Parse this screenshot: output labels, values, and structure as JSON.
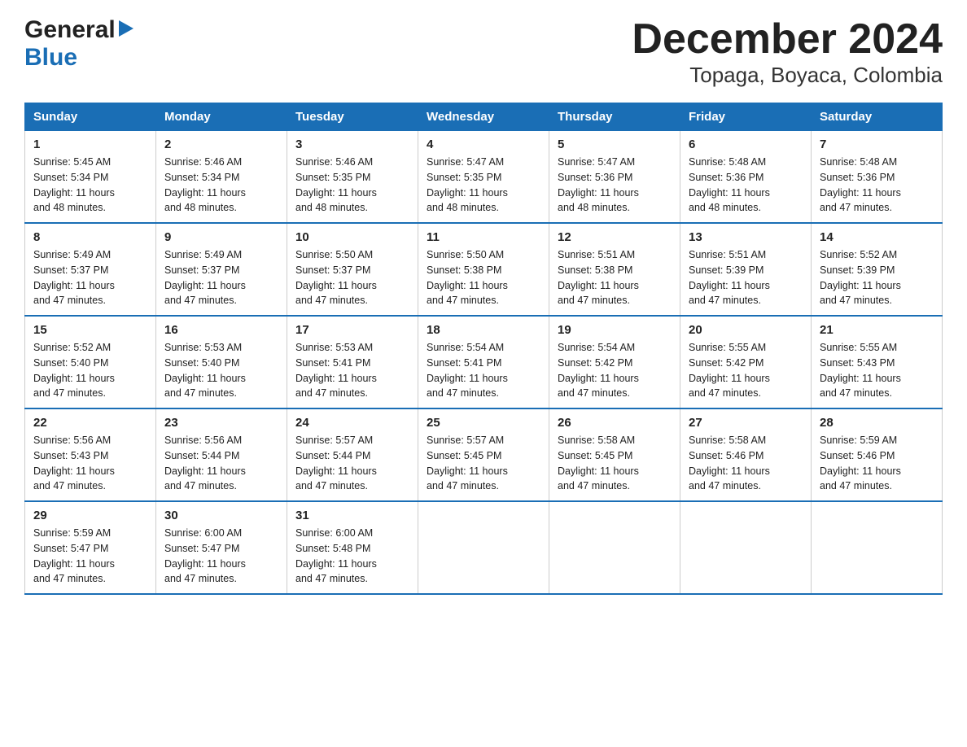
{
  "logo": {
    "general": "General",
    "triangle": "▶",
    "blue": "Blue"
  },
  "title": "December 2024",
  "subtitle": "Topaga, Boyaca, Colombia",
  "days_of_week": [
    "Sunday",
    "Monday",
    "Tuesday",
    "Wednesday",
    "Thursday",
    "Friday",
    "Saturday"
  ],
  "weeks": [
    [
      {
        "day": "1",
        "sunrise": "5:45 AM",
        "sunset": "5:34 PM",
        "daylight": "11 hours and 48 minutes."
      },
      {
        "day": "2",
        "sunrise": "5:46 AM",
        "sunset": "5:34 PM",
        "daylight": "11 hours and 48 minutes."
      },
      {
        "day": "3",
        "sunrise": "5:46 AM",
        "sunset": "5:35 PM",
        "daylight": "11 hours and 48 minutes."
      },
      {
        "day": "4",
        "sunrise": "5:47 AM",
        "sunset": "5:35 PM",
        "daylight": "11 hours and 48 minutes."
      },
      {
        "day": "5",
        "sunrise": "5:47 AM",
        "sunset": "5:36 PM",
        "daylight": "11 hours and 48 minutes."
      },
      {
        "day": "6",
        "sunrise": "5:48 AM",
        "sunset": "5:36 PM",
        "daylight": "11 hours and 48 minutes."
      },
      {
        "day": "7",
        "sunrise": "5:48 AM",
        "sunset": "5:36 PM",
        "daylight": "11 hours and 47 minutes."
      }
    ],
    [
      {
        "day": "8",
        "sunrise": "5:49 AM",
        "sunset": "5:37 PM",
        "daylight": "11 hours and 47 minutes."
      },
      {
        "day": "9",
        "sunrise": "5:49 AM",
        "sunset": "5:37 PM",
        "daylight": "11 hours and 47 minutes."
      },
      {
        "day": "10",
        "sunrise": "5:50 AM",
        "sunset": "5:37 PM",
        "daylight": "11 hours and 47 minutes."
      },
      {
        "day": "11",
        "sunrise": "5:50 AM",
        "sunset": "5:38 PM",
        "daylight": "11 hours and 47 minutes."
      },
      {
        "day": "12",
        "sunrise": "5:51 AM",
        "sunset": "5:38 PM",
        "daylight": "11 hours and 47 minutes."
      },
      {
        "day": "13",
        "sunrise": "5:51 AM",
        "sunset": "5:39 PM",
        "daylight": "11 hours and 47 minutes."
      },
      {
        "day": "14",
        "sunrise": "5:52 AM",
        "sunset": "5:39 PM",
        "daylight": "11 hours and 47 minutes."
      }
    ],
    [
      {
        "day": "15",
        "sunrise": "5:52 AM",
        "sunset": "5:40 PM",
        "daylight": "11 hours and 47 minutes."
      },
      {
        "day": "16",
        "sunrise": "5:53 AM",
        "sunset": "5:40 PM",
        "daylight": "11 hours and 47 minutes."
      },
      {
        "day": "17",
        "sunrise": "5:53 AM",
        "sunset": "5:41 PM",
        "daylight": "11 hours and 47 minutes."
      },
      {
        "day": "18",
        "sunrise": "5:54 AM",
        "sunset": "5:41 PM",
        "daylight": "11 hours and 47 minutes."
      },
      {
        "day": "19",
        "sunrise": "5:54 AM",
        "sunset": "5:42 PM",
        "daylight": "11 hours and 47 minutes."
      },
      {
        "day": "20",
        "sunrise": "5:55 AM",
        "sunset": "5:42 PM",
        "daylight": "11 hours and 47 minutes."
      },
      {
        "day": "21",
        "sunrise": "5:55 AM",
        "sunset": "5:43 PM",
        "daylight": "11 hours and 47 minutes."
      }
    ],
    [
      {
        "day": "22",
        "sunrise": "5:56 AM",
        "sunset": "5:43 PM",
        "daylight": "11 hours and 47 minutes."
      },
      {
        "day": "23",
        "sunrise": "5:56 AM",
        "sunset": "5:44 PM",
        "daylight": "11 hours and 47 minutes."
      },
      {
        "day": "24",
        "sunrise": "5:57 AM",
        "sunset": "5:44 PM",
        "daylight": "11 hours and 47 minutes."
      },
      {
        "day": "25",
        "sunrise": "5:57 AM",
        "sunset": "5:45 PM",
        "daylight": "11 hours and 47 minutes."
      },
      {
        "day": "26",
        "sunrise": "5:58 AM",
        "sunset": "5:45 PM",
        "daylight": "11 hours and 47 minutes."
      },
      {
        "day": "27",
        "sunrise": "5:58 AM",
        "sunset": "5:46 PM",
        "daylight": "11 hours and 47 minutes."
      },
      {
        "day": "28",
        "sunrise": "5:59 AM",
        "sunset": "5:46 PM",
        "daylight": "11 hours and 47 minutes."
      }
    ],
    [
      {
        "day": "29",
        "sunrise": "5:59 AM",
        "sunset": "5:47 PM",
        "daylight": "11 hours and 47 minutes."
      },
      {
        "day": "30",
        "sunrise": "6:00 AM",
        "sunset": "5:47 PM",
        "daylight": "11 hours and 47 minutes."
      },
      {
        "day": "31",
        "sunrise": "6:00 AM",
        "sunset": "5:48 PM",
        "daylight": "11 hours and 47 minutes."
      },
      null,
      null,
      null,
      null
    ]
  ],
  "labels": {
    "sunrise": "Sunrise:",
    "sunset": "Sunset:",
    "daylight": "Daylight:"
  }
}
